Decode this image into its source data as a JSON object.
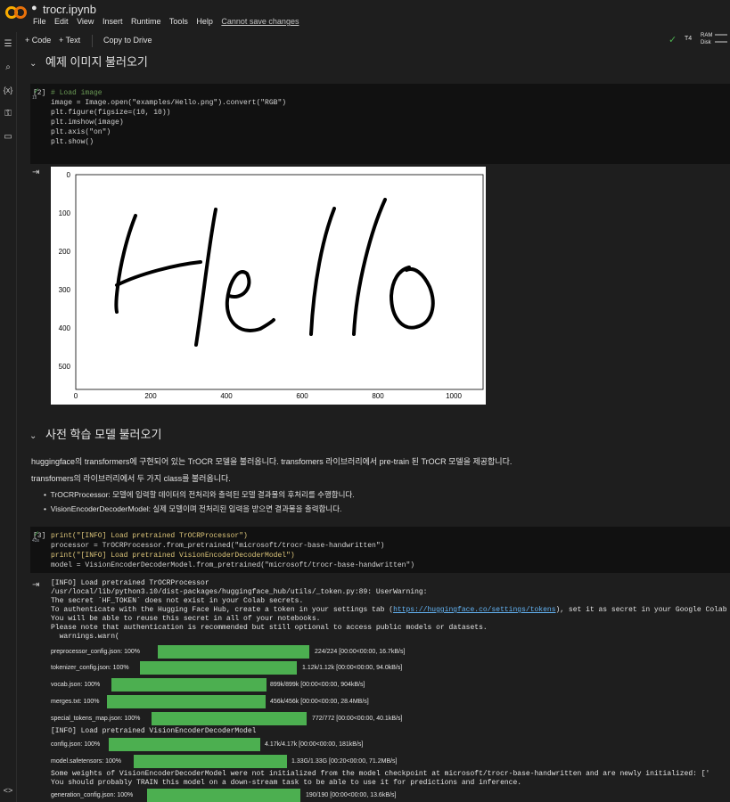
{
  "header": {
    "title": "trocr.ipynb",
    "menu": [
      "File",
      "Edit",
      "View",
      "Insert",
      "Runtime",
      "Tools",
      "Help"
    ],
    "warning": "Cannot save changes"
  },
  "toolbar": {
    "add_code": "+ Code",
    "add_text": "+ Text",
    "copy_drive": "Copy to Drive",
    "runtime": "T4",
    "ram": "RAM",
    "disk": "Disk"
  },
  "sections": {
    "s1": "예제 이미지 불러오기",
    "s2": "사전 학습 모델 불러오기"
  },
  "cell2": {
    "count": "[2]",
    "time": "1s",
    "lines": [
      "# Load image",
      "image = Image.open(\"examples/Hello.png\").convert(\"RGB\")",
      "",
      "plt.figure(figsize=(10, 10))",
      "plt.imshow(image)",
      "plt.axis(\"on\")",
      "plt.show()"
    ]
  },
  "chart_data": {
    "type": "image",
    "content": "Hello",
    "xticks": [
      "0",
      "200",
      "400",
      "600",
      "800",
      "1000"
    ],
    "yticks": [
      "0",
      "100",
      "200",
      "300",
      "400",
      "500"
    ],
    "xlim": [
      0,
      1070
    ],
    "ylim": [
      560,
      0
    ]
  },
  "prose": {
    "p1": "huggingface의 transformers에 구현되어 있는 TrOCR 모델을 불러옵니다. transfomers 라이브러리에서 pre-train 된 TrOCR 모델을 제공합니다.",
    "p2": "transfomers의 라이브러리에서 두 가지 class를 불러옵니다.",
    "b1": "TrOCRProcessor: 모델에 입력할 데이터의 전처리와 출력된 모델 결과물의 후처리를 수행합니다.",
    "b2": "VisionEncoderDecoderModel: 실제 모델이며 전처리된 입력을 받으면 결과물을 출력합니다."
  },
  "cell3": {
    "count": "[3]",
    "time": "43s",
    "lines": [
      "print(\"[INFO] Load pretrained TrOCRProcessor\")",
      "processor = TrOCRProcessor.from_pretrained(\"microsoft/trocr-base-handwritten\")",
      "print(\"[INFO] Load pretrained VisionEncoderDecoderModel\")",
      "model = VisionEncoderDecoderModel.from_pretrained(\"microsoft/trocr-base-handwritten\")"
    ]
  },
  "output3": {
    "l1": "[INFO] Load pretrained TrOCRProcessor",
    "l2": "/usr/local/lib/python3.10/dist-packages/huggingface_hub/utils/_token.py:89: UserWarning:",
    "l3": "The secret `HF_TOKEN` does not exist in your Colab secrets.",
    "l4a": "To authenticate with the Hugging Face Hub, create a token in your settings tab (",
    "l4link": "https://huggingface.co/settings/tokens",
    "l4b": "), set it as secret in your Google Colab and restart your session.",
    "l5": "You will be able to reuse this secret in all of your notebooks.",
    "l6": "Please note that authentication is recommended but still optional to access public models or datasets.",
    "l7": "  warnings.warn(",
    "progress1": [
      {
        "label": "preprocessor_config.json: 100%",
        "status": "224/224 [00:00<00:00, 16.7kB/s]"
      },
      {
        "label": "tokenizer_config.json: 100%",
        "status": "1.12k/1.12k [00:00<00:00, 94.0kB/s]"
      },
      {
        "label": "vocab.json: 100%",
        "status": "899k/899k [00:00<00:00, 904kB/s]"
      },
      {
        "label": "merges.txt: 100%",
        "status": "456k/456k [00:00<00:00, 28.4MB/s]"
      },
      {
        "label": "special_tokens_map.json: 100%",
        "status": "772/772 [00:00<00:00, 40.1kB/s]"
      }
    ],
    "l8": "[INFO] Load pretrained VisionEncoderDecoderModel",
    "progress2": [
      {
        "label": "config.json: 100%",
        "status": "4.17k/4.17k [00:00<00:00, 181kB/s]"
      },
      {
        "label": "model.safetensors: 100%",
        "status": "1.33G/1.33G [00:20<00:00, 71.2MB/s]"
      }
    ],
    "l9": "Some weights of VisionEncoderDecoderModel were not initialized from the model checkpoint at microsoft/trocr-base-handwritten and are newly initialized: ['",
    "l10": "You should probably TRAIN this model on a down-stream task to be able to use it for predictions and inference.",
    "progress3": [
      {
        "label": "generation_config.json: 100%",
        "status": "190/190 [00:00<00:00, 13.6kB/s]"
      }
    ]
  }
}
